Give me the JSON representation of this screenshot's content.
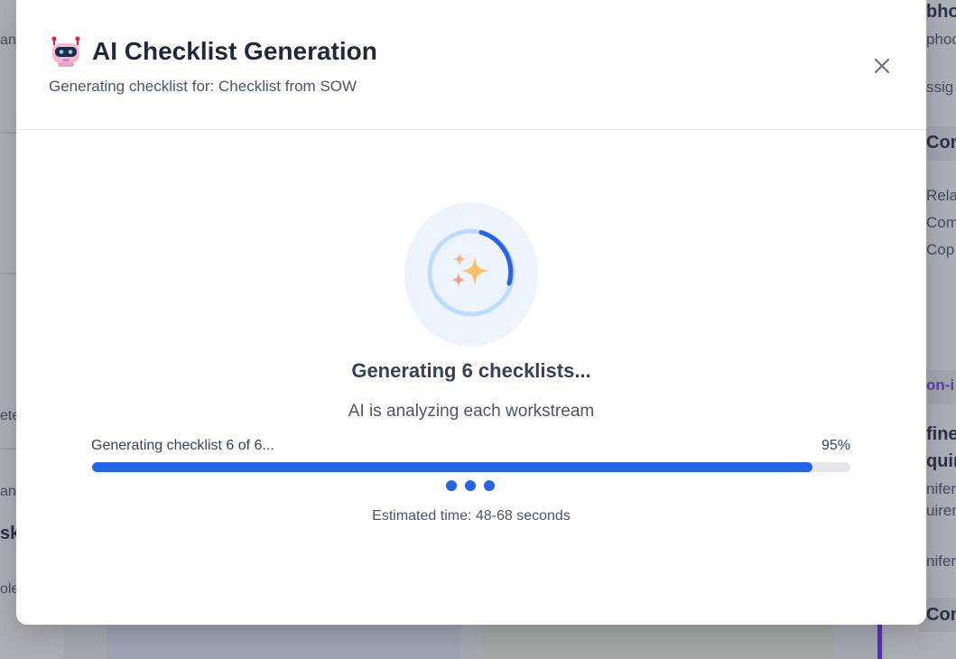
{
  "modal": {
    "title": "AI Checklist Generation",
    "subtitle": "Generating checklist for: Checklist from SOW",
    "icon": "robot-icon",
    "close_icon": "close-icon"
  },
  "progress": {
    "title": "Generating 6 checklists...",
    "subtitle": "AI is analyzing each workstream",
    "step_label": "Generating checklist 6 of 6...",
    "percent_label": "95%",
    "percent_value": 95,
    "estimate": "Estimated time: 48-68 seconds",
    "spinner_icon": "sparkles-icon"
  },
  "background": {
    "left_fragments": [
      "an",
      "ete",
      "an",
      "sk",
      "ole"
    ],
    "right_fragments": [
      "bho",
      "phoc",
      "ssig",
      "Com",
      "Rela",
      "Com",
      "Cop",
      "on-i",
      "fine",
      "quir",
      "nifer",
      "uirem",
      "nifer",
      "Com"
    ]
  },
  "colors": {
    "accent": "#2563eb",
    "track": "#e5e7eb",
    "overlay": "rgba(55,65,81,0.42)",
    "background_link": "#7c3aed"
  }
}
